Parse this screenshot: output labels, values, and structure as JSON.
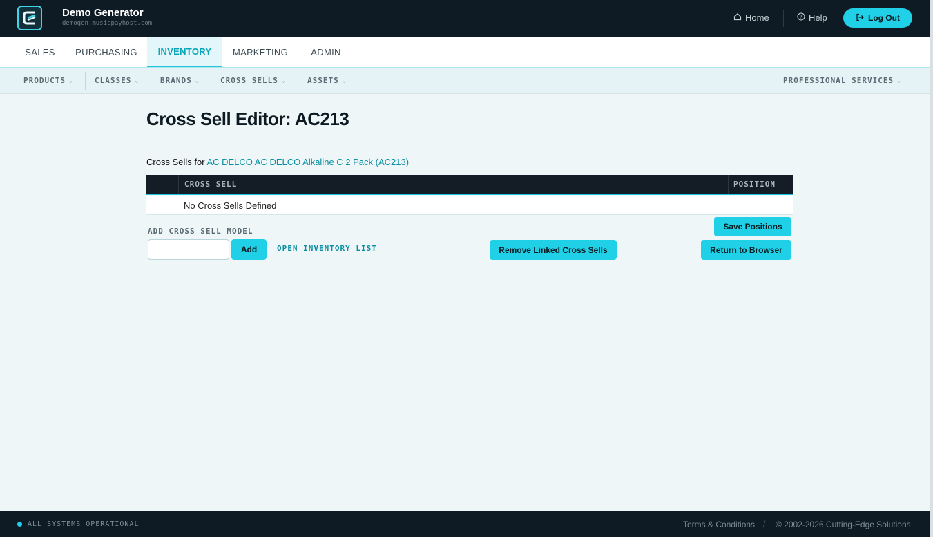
{
  "header": {
    "title": "Demo Generator",
    "subtitle": "demogen.musicpayhost.com",
    "home_label": "Home",
    "help_label": "Help",
    "logout_label": "Log Out"
  },
  "tabs": [
    {
      "label": "SALES"
    },
    {
      "label": "PURCHASING"
    },
    {
      "label": "INVENTORY",
      "active": true
    },
    {
      "label": "MARKETING"
    },
    {
      "label": "ADMIN"
    }
  ],
  "subnav": {
    "products": "PRODUCTS",
    "classes": "CLASSES",
    "brands": "BRANDS",
    "cross_sells": "CROSS SELLS",
    "assets": "ASSETS",
    "professional_services": "PROFESSIONAL SERVICES"
  },
  "main": {
    "title": "Cross Sell Editor: AC213",
    "cross_sells_for_prefix": "Cross Sells for",
    "product_link": "AC DELCO AC DELCO Alkaline C 2 Pack (AC213)",
    "table": {
      "columns": [
        "CROSS SELL",
        "POSITION"
      ],
      "empty_text": "No Cross Sells Defined"
    },
    "add_label": "ADD CROSS SELL MODEL",
    "add_input_value": "",
    "add_button": "Add",
    "open_inventory_link": "OPEN INVENTORY LIST",
    "save_positions_button": "Save Positions",
    "remove_linked_button": "Remove Linked Cross Sells",
    "return_button": "Return to Browser"
  },
  "footer": {
    "status": "ALL SYSTEMS OPERATIONAL",
    "terms": "Terms & Conditions",
    "separator": "/",
    "copyright": "© 2002-2026 Cutting-Edge Solutions"
  },
  "colors": {
    "accent": "#1fd0e6",
    "header_bg": "#0f1b24",
    "link": "#0a8fa3"
  }
}
